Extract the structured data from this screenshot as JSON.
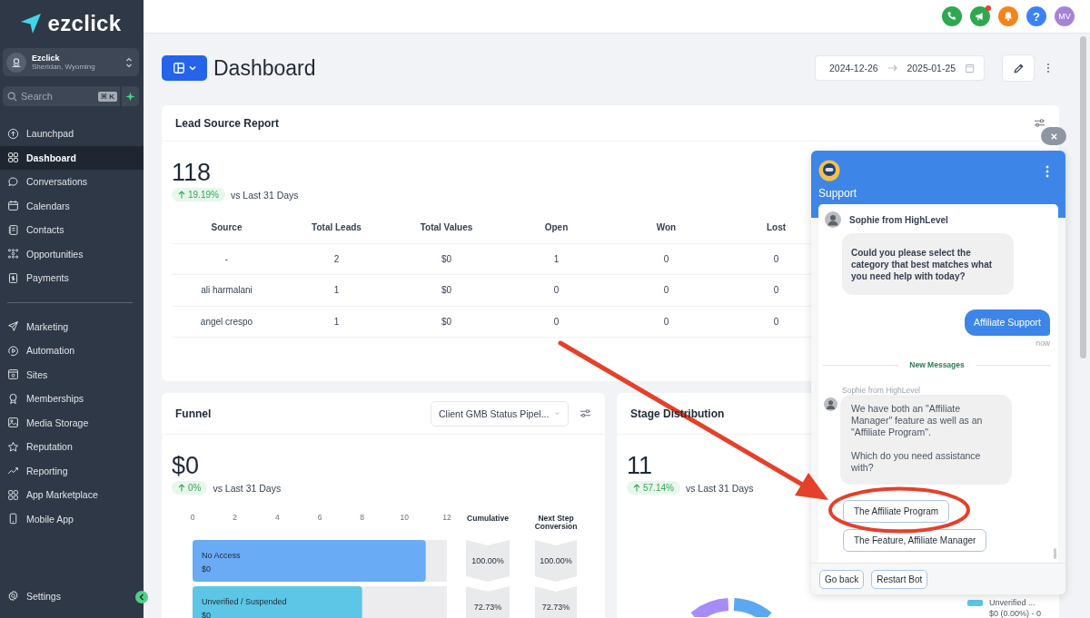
{
  "sidebar": {
    "logo": "ezclick",
    "account": {
      "name": "Ezclick",
      "location": "Sheridan, Wyoming"
    },
    "search": {
      "placeholder": "Search",
      "shortcut": "⌘ K"
    },
    "nav_groups": [
      [
        {
          "label": "Launchpad",
          "selected": false
        },
        {
          "label": "Dashboard",
          "selected": true
        },
        {
          "label": "Conversations",
          "selected": false
        },
        {
          "label": "Calendars",
          "selected": false
        },
        {
          "label": "Contacts",
          "selected": false
        },
        {
          "label": "Opportunities",
          "selected": false
        },
        {
          "label": "Payments",
          "selected": false
        }
      ],
      [
        {
          "label": "Marketing",
          "selected": false
        },
        {
          "label": "Automation",
          "selected": false
        },
        {
          "label": "Sites",
          "selected": false
        },
        {
          "label": "Memberships",
          "selected": false
        },
        {
          "label": "Media Storage",
          "selected": false
        },
        {
          "label": "Reputation",
          "selected": false
        },
        {
          "label": "Reporting",
          "selected": false
        },
        {
          "label": "App Marketplace",
          "selected": false
        },
        {
          "label": "Mobile App",
          "selected": false
        }
      ]
    ],
    "settings": "Settings"
  },
  "top_actions": [
    {
      "kind": "phone",
      "color": "#2ea84f",
      "badge": false
    },
    {
      "kind": "megaphone",
      "color": "#2ea84f",
      "badge": true
    },
    {
      "kind": "bell",
      "color": "#f7821b",
      "badge": false
    },
    {
      "kind": "help",
      "color": "#3b82f6",
      "badge": false,
      "label": "?"
    },
    {
      "kind": "avatar",
      "color": "#a783d6",
      "badge": false,
      "label": "MV"
    }
  ],
  "header": {
    "title": "Dashboard",
    "date_from": "2024-12-26",
    "date_to": "2025-01-25"
  },
  "lead_report": {
    "title": "Lead Source Report",
    "total": "118",
    "change": "19.19%",
    "comparison": "vs Last 31 Days",
    "columns": [
      "Source",
      "Total Leads",
      "Total Values",
      "Open",
      "Won",
      "Lost"
    ],
    "rows": [
      [
        "-",
        "2",
        "$0",
        "1",
        "0",
        "0"
      ],
      [
        "ali harmalani",
        "1",
        "$0",
        "0",
        "0",
        "0"
      ],
      [
        "angel crespo",
        "1",
        "$0",
        "0",
        "0",
        "0"
      ]
    ]
  },
  "funnel": {
    "title": "Funnel",
    "pipeline": "Client GMB Status Pipel...",
    "total": "$0",
    "change": "0%",
    "comparison": "vs Last 31 Days",
    "chart_data": {
      "type": "bar",
      "orientation": "horizontal",
      "categories": [
        "No Access",
        "Unverified / Suspended"
      ],
      "values": [
        11,
        8
      ],
      "xlim": [
        0,
        12
      ],
      "xticks": [
        0,
        2,
        4,
        6,
        8,
        10,
        12
      ]
    },
    "columns": [
      "Cumulative",
      "Next Step Conversion"
    ],
    "stages": [
      {
        "amount": "$0",
        "cumulative": "100.00%",
        "conversion": "100.00%",
        "color": "#6aabf6"
      },
      {
        "amount": "$0",
        "cumulative": "72.73%",
        "conversion": "72.73%",
        "color": "#5dc6e6"
      }
    ]
  },
  "stage_distribution": {
    "title": "Stage Distribution",
    "total": "11",
    "change": "57.14%",
    "comparison": "vs Last 31 Days",
    "legend": [
      {
        "label": "Unverified ...",
        "value": "$0 (0.00%) - 0",
        "color": "#5dc6e6"
      }
    ]
  },
  "chat": {
    "title": "Support",
    "agent": "Sophie from HighLevel",
    "messages": [
      {
        "kind": "bot",
        "emphasis": true,
        "text": "Could you please select the category that best matches what you need help with today?"
      },
      {
        "kind": "user",
        "text": "Affiliate Support",
        "time": "now"
      },
      {
        "kind": "divider",
        "text": "New Messages"
      },
      {
        "kind": "bot",
        "emphasis": false,
        "sender": "Sophie from HighLevel",
        "text": "We have both an \"Affiliate Manager\" feature as well as an \"Affiliate Program\".\n\nWhich do you need assistance with?"
      },
      {
        "kind": "option",
        "text": "The Affiliate Program"
      },
      {
        "kind": "option",
        "text": "The Feature, Affiliate Manager"
      }
    ],
    "footer_buttons": [
      "Go back",
      "Restart Bot"
    ]
  }
}
